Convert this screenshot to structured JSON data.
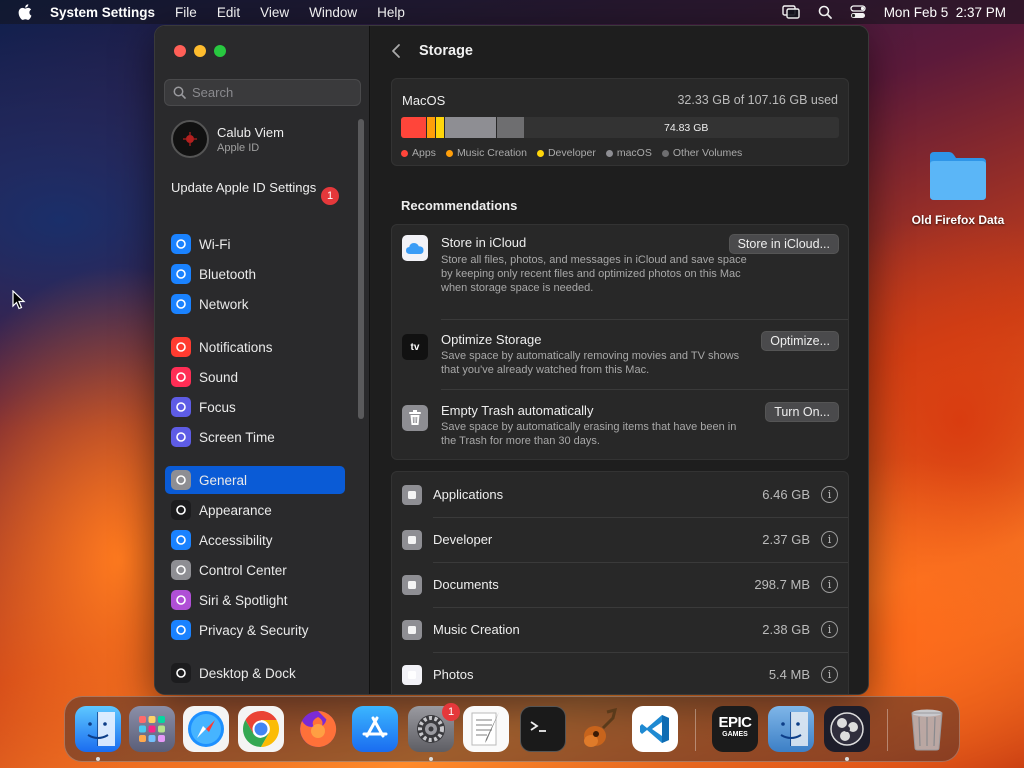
{
  "menubar": {
    "app_name": "System Settings",
    "menus": [
      "File",
      "Edit",
      "View",
      "Window",
      "Help"
    ],
    "datetime": "Mon Feb 5  2:37 PM"
  },
  "sidebar": {
    "search_placeholder": "Search",
    "account": {
      "name": "Calub Viem",
      "subtitle": "Apple ID"
    },
    "update": {
      "label": "Update Apple ID Settings",
      "badge": "1"
    },
    "items": [
      {
        "label": "Wi-Fi",
        "icon": "wifi-icon",
        "color": "#1a82ff"
      },
      {
        "label": "Bluetooth",
        "icon": "bluetooth-icon",
        "color": "#1a82ff"
      },
      {
        "label": "Network",
        "icon": "globe-icon",
        "color": "#1a82ff"
      },
      {
        "label": "Notifications",
        "icon": "bell-icon",
        "color": "#ff3b30"
      },
      {
        "label": "Sound",
        "icon": "speaker-icon",
        "color": "#ff2d55"
      },
      {
        "label": "Focus",
        "icon": "moon-icon",
        "color": "#5e5ce6"
      },
      {
        "label": "Screen Time",
        "icon": "hourglass-icon",
        "color": "#5e5ce6"
      },
      {
        "label": "General",
        "icon": "gear-icon",
        "color": "#8e8e93"
      },
      {
        "label": "Appearance",
        "icon": "appearance-icon",
        "color": "#1c1c1e"
      },
      {
        "label": "Accessibility",
        "icon": "accessibility-icon",
        "color": "#1a82ff"
      },
      {
        "label": "Control Center",
        "icon": "toggles-icon",
        "color": "#8e8e93"
      },
      {
        "label": "Siri & Spotlight",
        "icon": "siri-icon",
        "color": "#b04fd6"
      },
      {
        "label": "Privacy & Security",
        "icon": "hand-icon",
        "color": "#1a82ff"
      },
      {
        "label": "Desktop & Dock",
        "icon": "dock-icon",
        "color": "#1c1c1e"
      }
    ]
  },
  "main": {
    "title": "Storage",
    "disk": {
      "name": "MacOS",
      "used": "32.33 GB of 107.16 GB used",
      "free": "74.83 GB",
      "segments": [
        {
          "name": "Apps",
          "color": "#ff453a",
          "fraction": 0.058
        },
        {
          "name": "Music Creation",
          "color": "#ff9f0a",
          "fraction": 0.02
        },
        {
          "name": "Developer",
          "color": "#ffd60a",
          "fraction": 0.02
        },
        {
          "name": "macOS",
          "color": "#8e8e93",
          "fraction": 0.12
        },
        {
          "name": "Other Volumes",
          "color": "#6e6e70",
          "fraction": 0.063
        }
      ],
      "legend": [
        "Apps",
        "Music Creation",
        "Developer",
        "macOS",
        "Other Volumes"
      ]
    },
    "recommendations_title": "Recommendations",
    "recommendations": [
      {
        "title": "Store in iCloud",
        "desc": "Store all files, photos, and messages in iCloud and save space by keeping only recent files and optimized photos on this Mac when storage space is needed.",
        "button": "Store in iCloud..."
      },
      {
        "title": "Optimize Storage",
        "desc": "Save space by automatically removing movies and TV shows that you've already watched from this Mac.",
        "button": "Optimize...",
        "icon_text": "tv"
      },
      {
        "title": "Empty Trash automatically",
        "desc": "Save space by automatically erasing items that have been in the Trash for more than 30 days.",
        "button": "Turn On..."
      }
    ],
    "categories": [
      {
        "name": "Applications",
        "size": "6.46 GB",
        "icon": "apps-icon"
      },
      {
        "name": "Developer",
        "size": "2.37 GB",
        "icon": "hammer-icon"
      },
      {
        "name": "Documents",
        "size": "298.7 MB",
        "icon": "document-icon"
      },
      {
        "name": "Music Creation",
        "size": "2.38 GB",
        "icon": "piano-icon"
      },
      {
        "name": "Photos",
        "size": "5.4 MB",
        "icon": "photos-icon"
      }
    ]
  },
  "desktop": {
    "folder_label": "Old Firefox Data"
  },
  "dock": {
    "settings_badge": "1",
    "epic_line1": "EPIC",
    "epic_line2": "GAMES"
  }
}
